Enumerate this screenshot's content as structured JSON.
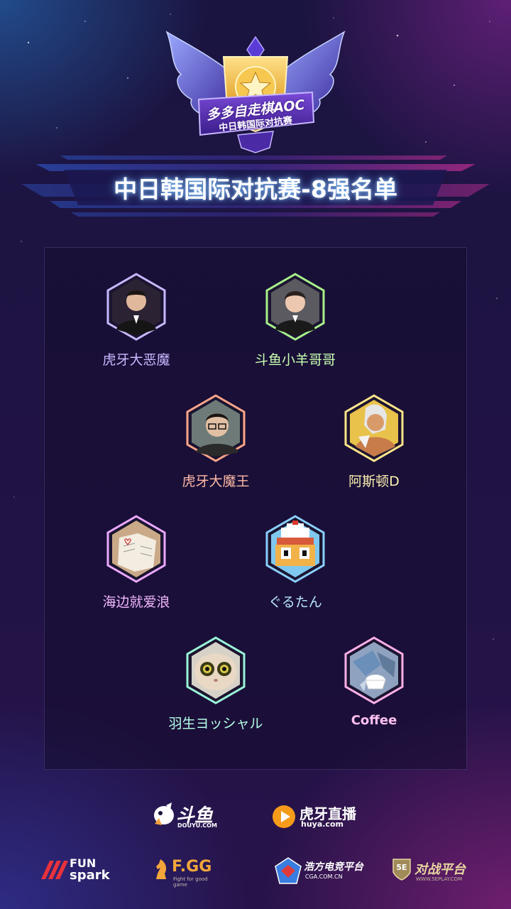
{
  "emblem": {
    "line1": "多多自走棋AOC",
    "line2": "中日韩国际对抗赛"
  },
  "title": "中日韩国际对抗赛-8强名单",
  "players": [
    {
      "name": "虎牙大恶魔",
      "color": "#c9b8ff",
      "avatar": "person-suit-avatar"
    },
    {
      "name": "斗鱼小羊哥哥",
      "color": "#c8ffb0",
      "avatar": "person-suit-avatar"
    },
    {
      "name": "虎牙大魔王",
      "color": "#ffb9a6",
      "avatar": "person-glasses-avatar"
    },
    {
      "name": "阿斯顿D",
      "color": "#fff1b0",
      "avatar": "anime-character-avatar"
    },
    {
      "name": "海边就爱浪",
      "color": "#f3b8ff",
      "avatar": "book-page-avatar"
    },
    {
      "name": "ぐるたん",
      "color": "#b8e6ff",
      "avatar": "pixel-character-avatar"
    },
    {
      "name": "羽生ヨッシャル",
      "color": "#b6ffe8",
      "avatar": "plush-toy-avatar"
    },
    {
      "name": "Coffee",
      "color": "#ffc0f0",
      "avatar": "coffee-cup-avatar"
    }
  ],
  "sponsors": {
    "douyu": {
      "name": "斗鱼",
      "sub": "DOUYU.COM"
    },
    "huya": {
      "name": "虎牙直播",
      "sub": "huya.com"
    },
    "funspark": {
      "line1": "FUN",
      "line2": "spark"
    },
    "fgg": {
      "name": "F.GG",
      "sub": "Fight for good game"
    },
    "cga": {
      "name": "浩方电竞平台",
      "sub": "CGA.COM.CN"
    },
    "play5e": {
      "badge": "5E",
      "name": "对战平台",
      "sub": "WWW.5EPLAY.COM"
    }
  },
  "colors": {
    "accent_blue": "#5fb4ff",
    "accent_pink": "#e24ab4",
    "gold": "#f2c14a"
  }
}
